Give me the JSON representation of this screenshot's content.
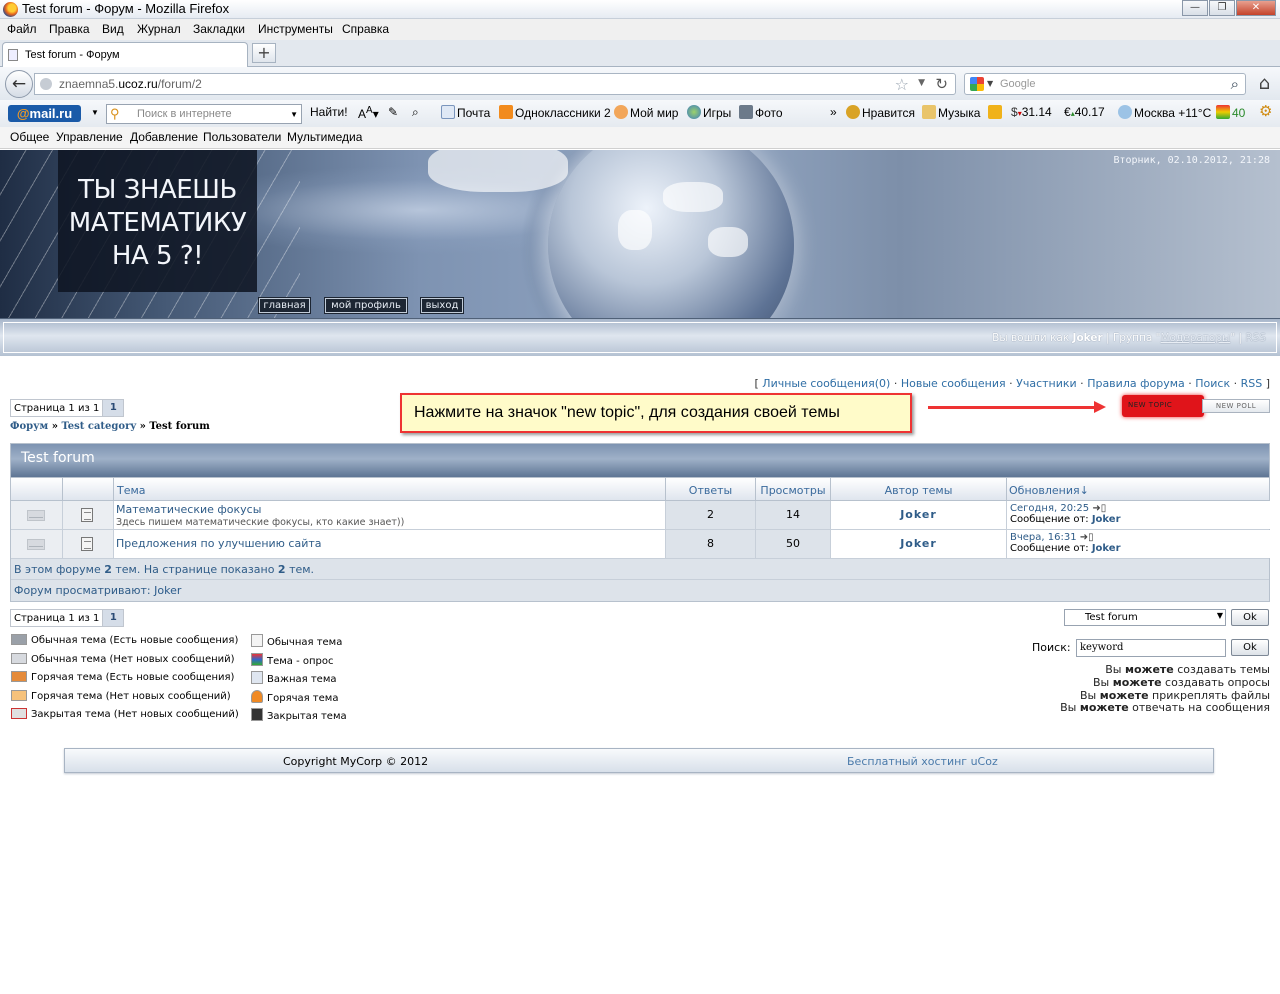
{
  "window": {
    "title": "Test forum - Форум - Mozilla Firefox",
    "controls": [
      "—",
      "❐",
      "✕"
    ]
  },
  "menubar": [
    "Файл",
    "Правка",
    "Вид",
    "Журнал",
    "Закладки",
    "Инструменты",
    "Справка"
  ],
  "tab": {
    "label": "Test forum - Форум",
    "new_tab": "+"
  },
  "navbar": {
    "url_prefix": "znaemna5.",
    "url_domain": "ucoz.ru",
    "url_path": "/forum/2",
    "search_placeholder": "Google"
  },
  "mailru": {
    "logo_at": "@",
    "logo_text": "mail.ru",
    "search_placeholder": "Поиск в интернете",
    "find": "Найти!",
    "items": [
      "Почта",
      "Одноклассники 2",
      "Мой мир",
      "Игры",
      "Фото",
      "»",
      "Нравится",
      "Музыка",
      "31.14",
      "40.17",
      "Москва +11°C",
      "40"
    ]
  },
  "site_menu": [
    "Общее",
    "Управление",
    "Добавление",
    "Пользователи",
    "Мультимедиа"
  ],
  "header": {
    "title_lines": [
      "ТЫ ЗНАЕШЬ",
      "МАТЕМАТИКУ",
      "НА 5 ?!"
    ],
    "date": "Вторник, 02.10.2012, 21:28",
    "buttons": [
      "главная",
      "мой профиль",
      "выход"
    ],
    "login_prefix": "Вы вошли как ",
    "login_user": "Joker",
    "login_group_prefix": " | Группа \"",
    "login_group": "Модераторы",
    "login_group_suffix": "\" | ",
    "login_rss": "RSS"
  },
  "toplinks": {
    "open": "[ ",
    "items": [
      "Личные сообщения(0)",
      "Новые сообщения",
      "Участники",
      "Правила форума",
      "Поиск",
      "RSS"
    ],
    "sep": " · ",
    "close": " ]"
  },
  "pager": {
    "label": "Страница 1 из 1",
    "page": "1"
  },
  "breadcrumb": {
    "forum": "Форум",
    "sep": " » ",
    "category": "Test category",
    "current": "Test forum"
  },
  "callout": "Нажмите на значок \"new topic\", для создания своей темы",
  "buttons": {
    "new_topic": "NEW TOPIC",
    "new_poll": "NEW POLL"
  },
  "forum": {
    "title": "Test forum",
    "columns": {
      "topic": "Тема",
      "replies": "Ответы",
      "views": "Просмотры",
      "author": "Автор темы",
      "updates": "Обновления↓"
    },
    "rows": [
      {
        "title": "Математические фокусы",
        "desc": "Здесь пишем математические фокусы, кто какие знает))",
        "replies": "2",
        "views": "14",
        "author": "Joker",
        "updated": "Сегодня, 20:25",
        "by_label": "Сообщение от: ",
        "by": "Joker"
      },
      {
        "title": "Предложения по улучшению сайта",
        "desc": "",
        "replies": "8",
        "views": "50",
        "author": "Joker",
        "updated": "Вчера, 16:31",
        "by_label": "Сообщение от: ",
        "by": "Joker"
      }
    ],
    "stats_a": "В этом форуме ",
    "stats_n1": "2",
    "stats_b": " тем. На странице показано ",
    "stats_n2": "2",
    "stats_c": " тем.",
    "viewing_label": "Форум просматривают: ",
    "viewing_user": "Joker"
  },
  "jump": {
    "selected": "Test forum",
    "ok": "Ok"
  },
  "legend": {
    "left": [
      "Обычная тема (Есть новые сообщения)",
      "Обычная тема (Нет новых сообщений)",
      "Горячая тема (Есть новые сообщения)",
      "Горячая тема (Нет новых сообщений)",
      "Закрытая тема (Нет новых сообщений)"
    ],
    "right": [
      "Обычная тема",
      "Тема - опрос",
      "Важная тема",
      "Горячая тема",
      "Закрытая тема"
    ]
  },
  "search": {
    "label": "Поиск:",
    "value": "keyword",
    "ok": "Ok"
  },
  "permissions": [
    {
      "pre": "Вы ",
      "bold": "можете",
      "post": " создавать темы"
    },
    {
      "pre": "Вы ",
      "bold": "можете",
      "post": " создавать опросы"
    },
    {
      "pre": "Вы ",
      "bold": "можете",
      "post": " прикреплять файлы"
    },
    {
      "pre": "Вы ",
      "bold": "можете",
      "post": " отвечать на сообщения"
    }
  ],
  "footer": {
    "copyright": "Copyright MyCorp © 2012",
    "hosting": "Бесплатный хостинг uCoz"
  },
  "colors": {
    "accent_red": "#e33333",
    "link": "#2f5c88",
    "header_bar": "#7d93b1"
  }
}
